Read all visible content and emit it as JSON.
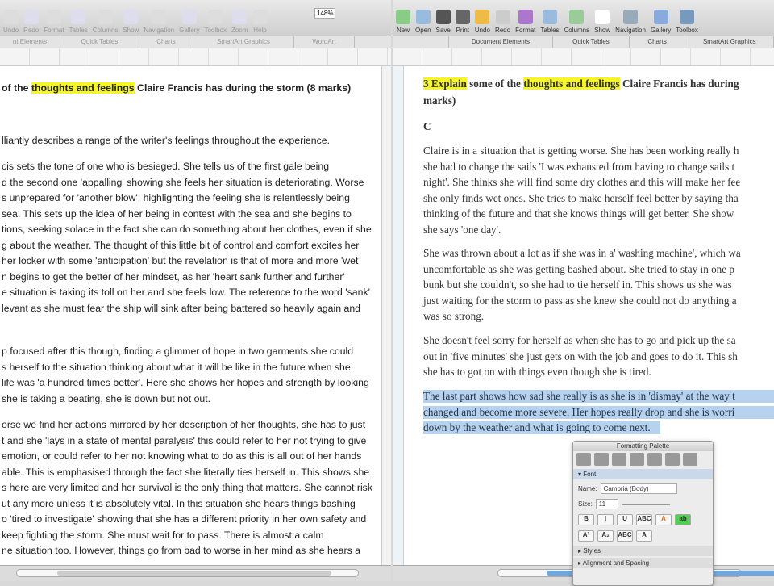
{
  "left_window": {
    "toolbar": [
      "Undo",
      "Redo",
      "Format",
      "Tables",
      "Columns",
      "Show",
      "Navigation",
      "Gallery",
      "Toolbox",
      "Zoom",
      "Help"
    ],
    "zoom_value": "148%",
    "ribbon_tabs": [
      "nt Elements",
      "Quick Tables",
      "Charts",
      "SmartArt Graphics",
      "WordArt"
    ],
    "title": {
      "pre": "of the ",
      "hl": "thoughts and feelings",
      "post": " Claire Francis has during the storm (8 marks)"
    },
    "lines": [
      "lliantly describes a range of the writer's feelings throughout the experience.",
      "cis sets the tone of one who is besieged. She tells us of the first gale being",
      "d the second one 'appalling' showing she feels her situation is deteriorating. Worse",
      "s unprepared for 'another blow', highlighting the feeling she is relentlessly being",
      " sea. This sets up the idea of her being in contest with the sea and she begins to",
      "tions, seeking solace in the fact she can do something about her clothes, even if she",
      "g about the weather. The thought of this little bit of control and comfort excites her",
      "her locker with some 'anticipation' but the revelation is that of more and more 'wet",
      "n begins to get the better of her mindset, as her 'heart sank further and further'",
      "e situation is taking its toll on her and she feels low. The reference to the word 'sank'",
      "levant as she must fear the ship will sink after being battered so heavily again and",
      "p focused after this though, finding a glimmer of hope in two garments she could",
      "s herself to the situation thinking about what it will be like in the future when she",
      "life was 'a hundred times better'. Here she shows her hopes and strength by looking",
      " she is taking a beating, she is down but not out.",
      "orse we find her actions mirrored by her description of her thoughts, she has to just",
      "t and she 'lays in a state of mental paralysis' this could refer to her not trying to give",
      " emotion, or could refer to her not knowing what to do as this is all out of her hands",
      "able. This is emphasised through the fact she literally ties herself in. This shows she",
      "s here are very limited and her survival is the only thing that matters. She cannot risk",
      "ut any more unless it is absolutely vital. In this situation she hears things bashing",
      "o 'tired to investigate' showing that she has a different priority in her own safety and",
      " keep fighting the storm. She must wait for to pass. There is almost a calm",
      "ne situation too.  However, things go from bad to worse in her mind as she hears a"
    ]
  },
  "right_window": {
    "toolbar": [
      "New",
      "Open",
      "Save",
      "Print",
      "Undo",
      "Redo",
      "Format",
      "Tables",
      "Columns",
      "Show",
      "Navigation",
      "Gallery",
      "Toolbox"
    ],
    "ribbon_tabs": [
      "Document Elements",
      "Quick Tables",
      "Charts",
      "SmartArt Graphics"
    ],
    "title": {
      "hl1": "3 Explain",
      "mid": " some of the ",
      "hl2": "thoughts and feelings",
      "post": " Claire Francis has during",
      "line2": "marks)"
    },
    "grade": "C",
    "lines": [
      "Claire is in a situation that is getting worse. She has been working really h",
      "she had to change the sails 'I was exhausted from having to change sails t",
      "night'. She thinks she will find some dry clothes and this will make her fee",
      "she only finds wet ones. She tries to make herself feel better by saying tha",
      "thinking of the future and that she knows things will get better. She show",
      "she says 'one day'.",
      "She was thrown about a lot as if she was in a' washing machine', which wa",
      "uncomfortable as she was getting bashed about. She tried to stay in one p",
      "bunk but she couldn't, so she had to tie herself in. This shows us she was",
      "just waiting for the storm to pass as she knew she could not do anything a",
      "was so strong.",
      "She doesn't feel sorry for herself as when she has to go and pick up the sa",
      "out in 'five minutes' she just gets on with the job and goes to do it. This sh",
      "she has to got on with things even though she is tired."
    ],
    "selected_lines": [
      "The last part shows how sad she really is as she is in 'dismay' at the way t",
      "changed and become more severe. Her hopes really drop and she is worri",
      "down by the weather and what is going to come next."
    ]
  },
  "palette": {
    "title": "Formatting Palette",
    "font_section": "Font",
    "name_label": "Name:",
    "name_value": "Cambria (Body)",
    "size_label": "Size:",
    "size_value": "11",
    "buttons": [
      "B",
      "I",
      "U",
      "ABC",
      "A",
      "ab"
    ],
    "buttons2": [
      "A²",
      "A₂",
      "ABC",
      "A"
    ],
    "styles": "Styles",
    "alignment": "Alignment and Spacing",
    "accent": "#c9d9ea"
  }
}
